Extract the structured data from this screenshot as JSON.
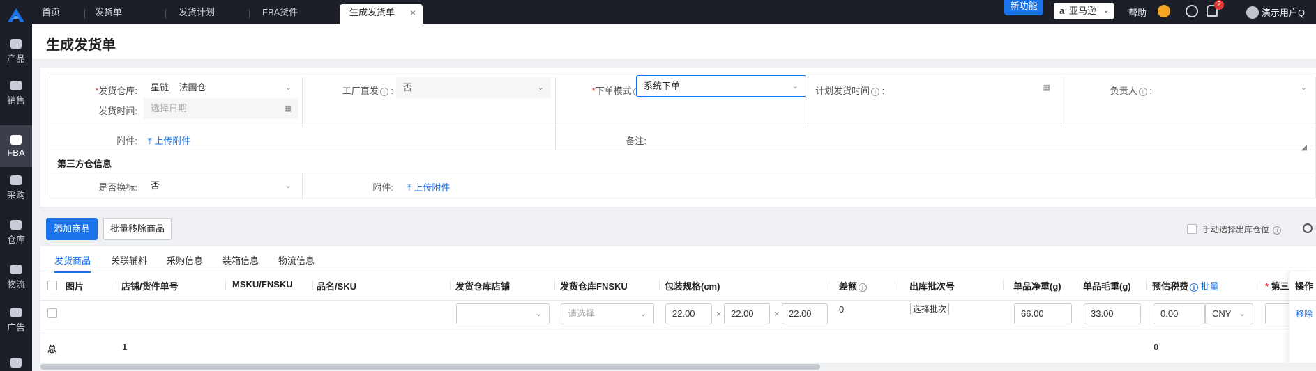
{
  "sidebar": {
    "logo": "A",
    "items": [
      {
        "label": "产品",
        "icon": "box-icon"
      },
      {
        "label": "销售",
        "icon": "sell-icon"
      },
      {
        "label": "FBA",
        "icon": "amazon-icon"
      },
      {
        "label": "采购",
        "icon": "cart-icon"
      },
      {
        "label": "仓库",
        "icon": "warehouse-icon"
      },
      {
        "label": "物流",
        "icon": "truck-icon"
      },
      {
        "label": "广告",
        "icon": "ad-icon"
      },
      {
        "label": "",
        "icon": "mail-icon"
      }
    ]
  },
  "topbar": {
    "tabs": [
      "首页",
      "发货单",
      "发货计划",
      "FBA货件",
      "生成发货单"
    ],
    "close_icon": "×",
    "new_feature": "新功能",
    "marketplace": "亚马逊",
    "help": "帮助",
    "notification_count": "2",
    "username": "演示用户Q"
  },
  "page": {
    "title": "生成发货单"
  },
  "form": {
    "warehouse_label": "发货仓库:",
    "warehouse_value_1": "星链",
    "warehouse_value_2": "法国仓",
    "factory_direct_label": "工厂直发",
    "factory_direct_value": "否",
    "order_mode_label": "下单模式",
    "order_mode_value": "系统下单",
    "planned_ship_time_label": "计划发货时间",
    "owner_label": "负责人",
    "ship_time_label": "发货时间:",
    "ship_time_placeholder": "选择日期",
    "attachment_label": "附件:",
    "upload_attachment": "上传附件",
    "remark_label": "备注:",
    "third_party_title": "第三方仓信息",
    "relabel_label": "是否换标:",
    "relabel_value": "否",
    "attachment2_label": "附件:",
    "upload_attachment2": "上传附件"
  },
  "toolbar": {
    "add_product": "添加商品",
    "batch_remove": "批量移除商品",
    "manual_select_location": "手动选择出库仓位"
  },
  "table": {
    "tabs": [
      "发货商品",
      "关联辅料",
      "采购信息",
      "装箱信息",
      "物流信息"
    ],
    "headers": {
      "image": "图片",
      "shop": "店铺/货件单号",
      "msku": "MSKU/FNSKU",
      "name": "品名/SKU",
      "ship_shop": "发货仓库店铺",
      "ship_fnsku": "发货仓库FNSKU",
      "pack_spec": "包装规格(cm)",
      "diff": "差额",
      "batch": "出库批次号",
      "net_weight": "单品净重(g)",
      "gross_weight": "单品毛重(g)",
      "tax": "预估税费",
      "tax_batch": "批量",
      "third": "第三",
      "action": "操作"
    },
    "row": {
      "fnsku_placeholder": "请选择",
      "length": "22.00",
      "width": "22.00",
      "height": "22.00",
      "diff": "0",
      "batch_button": "选择批次",
      "net_weight": "66.00",
      "gross_weight": "33.00",
      "tax": "0.00",
      "currency": "CNY",
      "remove": "移除"
    },
    "footer": {
      "total_label": "总",
      "count": "1",
      "tax_total": "0"
    }
  }
}
